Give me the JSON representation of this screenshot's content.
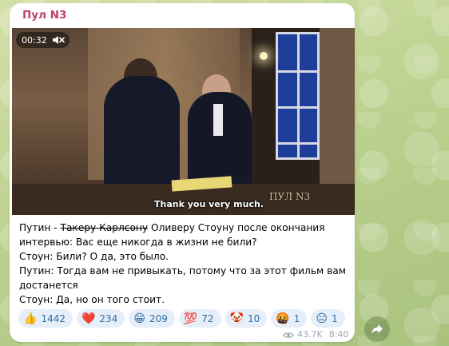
{
  "channel": {
    "name": "Пул N3"
  },
  "video": {
    "duration": "00:32",
    "subtitle": "Thank you very much.",
    "watermark": "ПУЛ N3",
    "mute_icon": "muted-speaker-icon"
  },
  "message": {
    "line1_prefix": "Путин - ",
    "line1_struck": "Такеру Карлсону",
    "line1_suffix": " Оливеру Стоуну после окончания интервью: Вас еще никогда в жизни не били?",
    "line2": "Стоун: Били? О да, это было.",
    "line3": "Путин: Тогда вам не привыкать, потому что за этот фильм вам достанется",
    "line4": "Стоун: Да, но он того стоит."
  },
  "reactions": [
    {
      "emoji": "👍",
      "count": "1442"
    },
    {
      "emoji": "❤️",
      "count": "234"
    },
    {
      "emoji": "😁",
      "count": "209"
    },
    {
      "emoji": "💯",
      "count": "72"
    },
    {
      "emoji": "🤡",
      "count": "10"
    },
    {
      "emoji": "🤬",
      "count": "1"
    },
    {
      "emoji": "😐",
      "count": "1"
    }
  ],
  "meta": {
    "views": "43.7K",
    "time": "8:40",
    "views_icon": "eye-icon"
  },
  "share": {
    "icon": "share-arrow-icon"
  },
  "colors": {
    "channel_name": "#c03d6e",
    "reaction_bg": "#e6eff9",
    "reaction_text": "#2f6ea5",
    "wallpaper": "#c9d9a0"
  }
}
